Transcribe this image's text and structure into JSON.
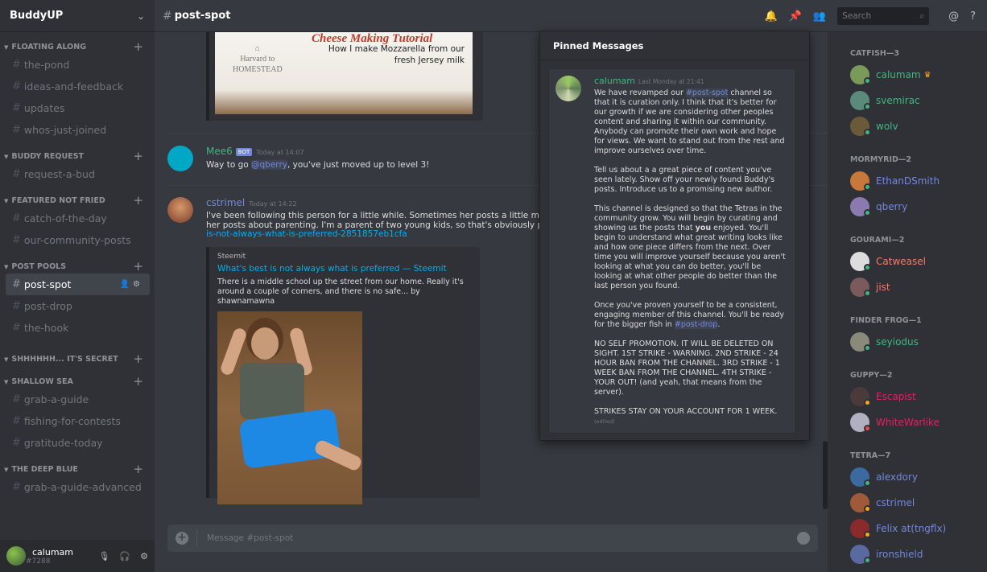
{
  "server": {
    "name": "BuddyUP"
  },
  "categories": [
    {
      "name": "FLOATING ALONG",
      "channels": [
        "the-pond",
        "ideas-and-feedback",
        "updates",
        "whos-just-joined"
      ]
    },
    {
      "name": "BUDDY REQUEST",
      "channels": [
        "request-a-bud"
      ]
    },
    {
      "name": "FEATURED NOT FRIED",
      "channels": [
        "catch-of-the-day",
        "our-community-posts"
      ]
    },
    {
      "name": "POST POOLS",
      "channels": [
        "post-spot",
        "post-drop",
        "the-hook"
      ]
    },
    {
      "name": "SHHHHHH... IT'S SECRET",
      "channels": []
    },
    {
      "name": "SHALLOW SEA",
      "channels": [
        "grab-a-guide",
        "fishing-for-contests",
        "gratitude-today"
      ]
    },
    {
      "name": "THE DEEP BLUE",
      "channels": [
        "grab-a-guide-advanced"
      ]
    }
  ],
  "user": {
    "name": "calumam",
    "tag": "#7288"
  },
  "header": {
    "channel": "post-spot",
    "search_placeholder": "Search"
  },
  "top_embed": {
    "brand_line1": "Harvard to",
    "brand_line2": "HOMESTEAD",
    "title": "Cheese Making Tutorial",
    "subtitle": "How I make Mozzarella from our fresh Jersey milk"
  },
  "messages": [
    {
      "author": "Mee6",
      "bot": "BOT",
      "time": "Today at 14:07",
      "pre": "Way to go ",
      "mention": "@qberry",
      "post": ", you've just moved up to level 3!",
      "color": "#43b581"
    },
    {
      "author": "cstrimel",
      "time": "Today at 14:22",
      "color": "#7289da",
      "line1": "I've been following this person for a little while. Sometimes her posts a little more story tha",
      "line2": "her posts about parenting. I'm a parent of two young kids, so that's obviously part of my int",
      "line3": "is-not-always-what-is-preferred-2851857eb1cfa",
      "embed": {
        "provider": "Steemit",
        "title": "What's best is not always what is preferred — Steemit",
        "description": "There is a middle school up the street from our home. Really it's around a couple of corners, and there is no safe... by shawnamawna"
      }
    }
  ],
  "composer": {
    "placeholder": "Message #post-spot"
  },
  "pinned": {
    "title": "Pinned Messages",
    "author": "calumam",
    "time": "Last Monday at 21:41",
    "p1_a": "We have revamped our ",
    "p1_link": "#post-spot",
    "p1_b": " channel so that it is curation only. I think that it's better for our growth if we are considering other peoples content and sharing it within our community. Anybody can promote their own work and hope for views. We want to stand out from the rest and improve ourselves over time.",
    "p2": "Tell us about a a great piece of content you've seen lately. Show off your newly found Buddy's posts. Introduce us to a promising new author.",
    "p3_a": "This channel is designed so that the Tetras in the community grow. You will begin by curating and showing us the posts that ",
    "p3_bold": "you",
    "p3_b": " enjoyed. You'll begin to understand what great writing looks like and how one piece differs from the next. Over time you will improve yourself because you aren't looking at what you can do better, you'll be looking at what other people do better than the last person you found.",
    "p4_a": "Once you've proven yourself to be a consistent, engaging member of this channel. You'll be ready for the bigger fish in ",
    "p4_link": "#post-drop",
    "p4_b": ".",
    "p5": "NO SELF PROMOTION. IT WILL BE DELETED ON SIGHT. 1ST STRIKE - WARNING. 2ND STRIKE - 24 HOUR BAN FROM THE CHANNEL. 3RD STRIKE - 1 WEEK BAN FROM THE CHANNEL. 4TH STRIKE - YOUR OUT! (and yeah, that means from the server).",
    "p6": "STRIKES STAY ON YOUR ACCOUNT FOR 1 WEEK.",
    "edited": "(edited)"
  },
  "member_groups": [
    {
      "label": "CATFISH—3",
      "members": [
        {
          "name": "calumam",
          "color": "#43b581",
          "status": "on",
          "crown": true,
          "av": "#7a9a5a"
        },
        {
          "name": "svemirac",
          "color": "#43b581",
          "status": "on",
          "av": "#5a8a7a"
        },
        {
          "name": "wolv",
          "color": "#43b581",
          "status": "on",
          "av": "#6b5a3a"
        }
      ]
    },
    {
      "label": "MORMYRID—2",
      "members": [
        {
          "name": "EthanDSmith",
          "color": "#7289da",
          "status": "on",
          "av": "#c8783a"
        },
        {
          "name": "qberry",
          "color": "#7289da",
          "status": "on",
          "av": "#8a7ab0"
        }
      ]
    },
    {
      "label": "GOURAMI—2",
      "members": [
        {
          "name": "Catweasel",
          "color": "#f47b67",
          "status": "on",
          "av": "#dddddd"
        },
        {
          "name": "jist",
          "color": "#f47b67",
          "status": "on",
          "av": "#7a5a5a"
        }
      ]
    },
    {
      "label": "FINDER FROG—1",
      "members": [
        {
          "name": "seyiodus",
          "color": "#43b581",
          "status": "on",
          "av": "#8a8a7a"
        }
      ]
    },
    {
      "label": "GUPPY—2",
      "members": [
        {
          "name": "Escapist",
          "color": "#e91e63",
          "status": "idle",
          "av": "#4a3a3a"
        },
        {
          "name": "WhiteWarlike",
          "color": "#e91e63",
          "status": "dnd",
          "av": "#b0b0c0"
        }
      ]
    },
    {
      "label": "TETRA—7",
      "members": [
        {
          "name": "alexdory",
          "color": "#7289da",
          "status": "on",
          "av": "#3a6aa0"
        },
        {
          "name": "cstrimel",
          "color": "#7289da",
          "status": "idle",
          "av": "#a05a3a"
        },
        {
          "name": "Felix at(tngflx)",
          "color": "#7289da",
          "status": "idle",
          "av": "#8a2a2a"
        },
        {
          "name": "ironshield",
          "color": "#7289da",
          "status": "on",
          "av": "#5a6aa0"
        }
      ]
    }
  ]
}
